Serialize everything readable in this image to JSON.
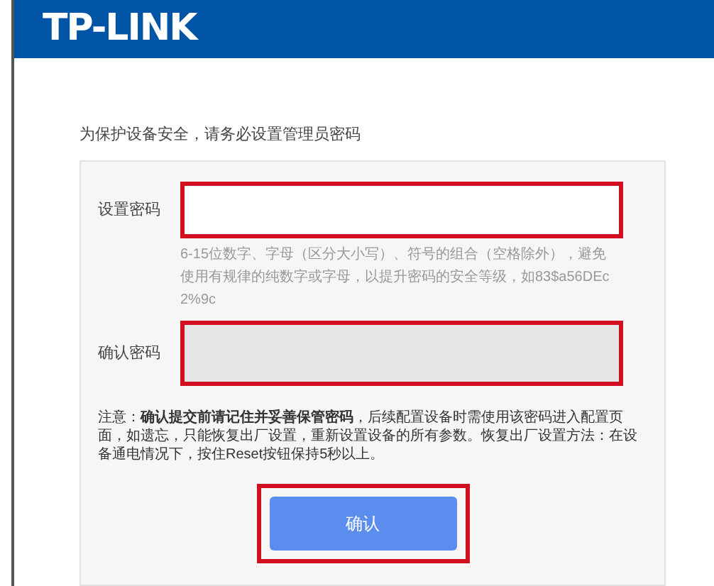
{
  "header": {
    "logo": "TP-LINK"
  },
  "intro": "为保护设备安全，请务必设置管理员密码",
  "form": {
    "fields": [
      {
        "label": "设置密码",
        "hint": "6-15位数字、字母（区分大小写）、符号的组合（空格除外），避免使用有规律的纯数字或字母，以提升密码的安全等级，如83$a56DEc2%9c"
      },
      {
        "label": "确认密码"
      }
    ],
    "note": "注意：**确认提交前请记住并妥善保管密码**，后续配置设备时需使用该密码进入配置页面，如遗忘，只能恢复出厂设置，重新设置设备的所有参数。恢复出厂设置方法：在设备通电情况下，按住Reset按钮保持5秒以上。",
    "submit": "确认"
  }
}
